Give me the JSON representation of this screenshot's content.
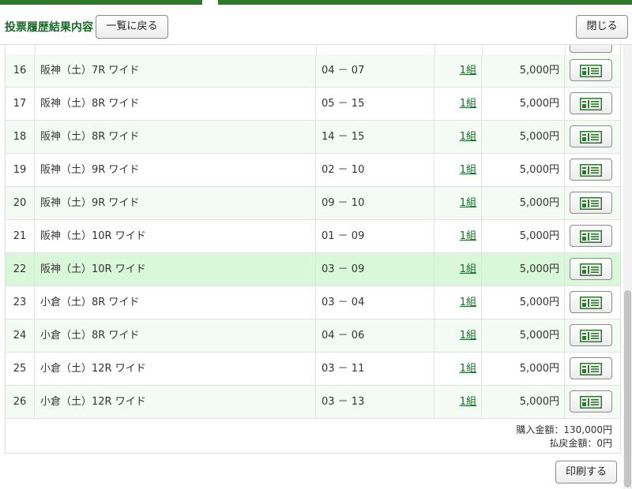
{
  "header": {
    "title": "投票履歴結果内容",
    "back_label": "一覧に戻る",
    "close_label": "閉じる"
  },
  "rows": [
    {
      "no": "16",
      "race": "阪神（土）7R ワイド",
      "combo": "04 － 07",
      "count": "1組",
      "amount": "5,000円"
    },
    {
      "no": "17",
      "race": "阪神（土）8R ワイド",
      "combo": "05 － 15",
      "count": "1組",
      "amount": "5,000円"
    },
    {
      "no": "18",
      "race": "阪神（土）8R ワイド",
      "combo": "14 － 15",
      "count": "1組",
      "amount": "5,000円"
    },
    {
      "no": "19",
      "race": "阪神（土）9R ワイド",
      "combo": "02 － 10",
      "count": "1組",
      "amount": "5,000円"
    },
    {
      "no": "20",
      "race": "阪神（土）9R ワイド",
      "combo": "09 － 10",
      "count": "1組",
      "amount": "5,000円"
    },
    {
      "no": "21",
      "race": "阪神（土）10R ワイド",
      "combo": "01 － 09",
      "count": "1組",
      "amount": "5,000円"
    },
    {
      "no": "22",
      "race": "阪神（土）10R ワイド",
      "combo": "03 － 09",
      "count": "1組",
      "amount": "5,000円"
    },
    {
      "no": "23",
      "race": "小倉（土）8R ワイド",
      "combo": "03 － 04",
      "count": "1組",
      "amount": "5,000円"
    },
    {
      "no": "24",
      "race": "小倉（土）8R ワイド",
      "combo": "04 － 06",
      "count": "1組",
      "amount": "5,000円"
    },
    {
      "no": "25",
      "race": "小倉（土）12R ワイド",
      "combo": "03 － 11",
      "count": "1組",
      "amount": "5,000円"
    },
    {
      "no": "26",
      "race": "小倉（土）12R ワイド",
      "combo": "03 － 13",
      "count": "1組",
      "amount": "5,000円"
    }
  ],
  "highlighted_row": "22",
  "totals": {
    "purchase": "購入金額：130,000円",
    "refund": "払戻金額：0円"
  },
  "footer": {
    "print_label": "印刷する"
  },
  "colors": {
    "accent": "#1a6a2a",
    "highlight_row": "#d9f7d9",
    "ticket_icon": "#2a7a2a"
  },
  "icons": {
    "ticket_button": "ticket-icon"
  }
}
